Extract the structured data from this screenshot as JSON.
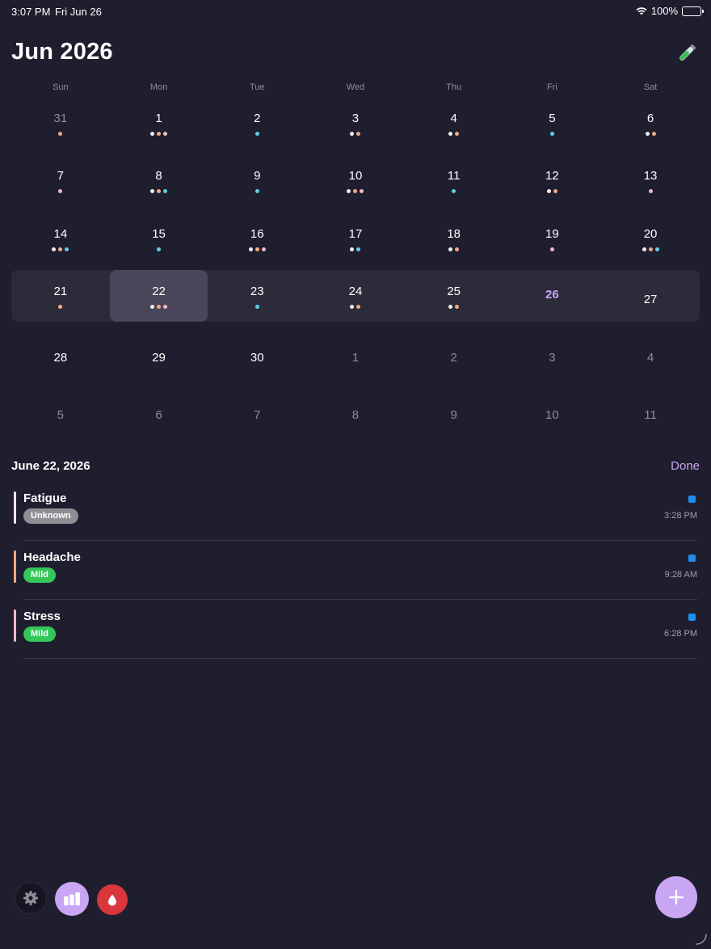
{
  "status": {
    "time": "3:07 PM",
    "date": "Fri Jun 26",
    "battery": "100%"
  },
  "calendar": {
    "title": "Jun 2026",
    "weekdays": [
      "Sun",
      "Mon",
      "Tue",
      "Wed",
      "Thu",
      "Fri",
      "Sat"
    ],
    "colors": {
      "white": "#f0eef2",
      "pink": "#f1b8c8",
      "orange": "#f2a983",
      "cyan": "#5fd0e3"
    },
    "weeks": [
      [
        {
          "n": "31",
          "muted": true,
          "dots": [
            "orange"
          ]
        },
        {
          "n": "1",
          "dots": [
            "white",
            "orange",
            "pink"
          ]
        },
        {
          "n": "2",
          "dots": [
            "cyan"
          ]
        },
        {
          "n": "3",
          "dots": [
            "white",
            "orange"
          ]
        },
        {
          "n": "4",
          "dots": [
            "white",
            "orange"
          ]
        },
        {
          "n": "5",
          "dots": [
            "cyan"
          ]
        },
        {
          "n": "6",
          "dots": [
            "white",
            "orange"
          ]
        }
      ],
      [
        {
          "n": "7",
          "dots": [
            "pink"
          ]
        },
        {
          "n": "8",
          "dots": [
            "white",
            "orange",
            "cyan"
          ]
        },
        {
          "n": "9",
          "dots": [
            "cyan"
          ]
        },
        {
          "n": "10",
          "dots": [
            "white",
            "orange",
            "pink"
          ]
        },
        {
          "n": "11",
          "dots": [
            "cyan"
          ]
        },
        {
          "n": "12",
          "dots": [
            "white",
            "orange"
          ]
        },
        {
          "n": "13",
          "dots": [
            "pink"
          ]
        }
      ],
      [
        {
          "n": "14",
          "dots": [
            "white",
            "orange",
            "cyan"
          ]
        },
        {
          "n": "15",
          "dots": [
            "cyan"
          ]
        },
        {
          "n": "16",
          "dots": [
            "white",
            "orange",
            "pink"
          ]
        },
        {
          "n": "17",
          "dots": [
            "white",
            "cyan"
          ]
        },
        {
          "n": "18",
          "dots": [
            "white",
            "orange"
          ]
        },
        {
          "n": "19",
          "dots": [
            "pink"
          ]
        },
        {
          "n": "20",
          "dots": [
            "white",
            "orange",
            "cyan"
          ]
        }
      ],
      [
        {
          "n": "21",
          "dots": [
            "orange"
          ]
        },
        {
          "n": "22",
          "selected": true,
          "dots": [
            "white",
            "orange",
            "pink"
          ]
        },
        {
          "n": "23",
          "dots": [
            "cyan"
          ]
        },
        {
          "n": "24",
          "dots": [
            "white",
            "orange"
          ]
        },
        {
          "n": "25",
          "dots": [
            "white",
            "orange"
          ]
        },
        {
          "n": "26",
          "today": true,
          "dots": []
        },
        {
          "n": "27",
          "dots": []
        }
      ],
      [
        {
          "n": "28",
          "dots": []
        },
        {
          "n": "29",
          "dots": []
        },
        {
          "n": "30",
          "dots": []
        },
        {
          "n": "1",
          "muted": true,
          "dots": []
        },
        {
          "n": "2",
          "muted": true,
          "dots": []
        },
        {
          "n": "3",
          "muted": true,
          "dots": []
        },
        {
          "n": "4",
          "muted": true,
          "dots": []
        }
      ],
      [
        {
          "n": "5",
          "muted": true,
          "dots": []
        },
        {
          "n": "6",
          "muted": true,
          "dots": []
        },
        {
          "n": "7",
          "muted": true,
          "dots": []
        },
        {
          "n": "8",
          "muted": true,
          "dots": []
        },
        {
          "n": "9",
          "muted": true,
          "dots": []
        },
        {
          "n": "10",
          "muted": true,
          "dots": []
        },
        {
          "n": "11",
          "muted": true,
          "dots": []
        }
      ]
    ]
  },
  "day_detail": {
    "date_label": "June 22, 2026",
    "done_label": "Done",
    "entries": [
      {
        "name": "Fatigue",
        "severity": "Unknown",
        "severity_color": "#8f8e96",
        "bar_color": "#f3e3ea",
        "time": "3:28 PM"
      },
      {
        "name": "Headache",
        "severity": "Mild",
        "severity_color": "#33c659",
        "bar_color": "#f2a983",
        "time": "9:28 AM"
      },
      {
        "name": "Stress",
        "severity": "Mild",
        "severity_color": "#33c659",
        "bar_color": "#f1b8c8",
        "time": "6:28 PM"
      }
    ]
  },
  "toolbar": {
    "settings_icon": "gear-icon",
    "stats_icon": "bar-chart-icon",
    "period_icon": "drop-icon",
    "add_icon": "plus-icon",
    "accent": "#c8a6f3",
    "period_color": "#d9363e"
  }
}
